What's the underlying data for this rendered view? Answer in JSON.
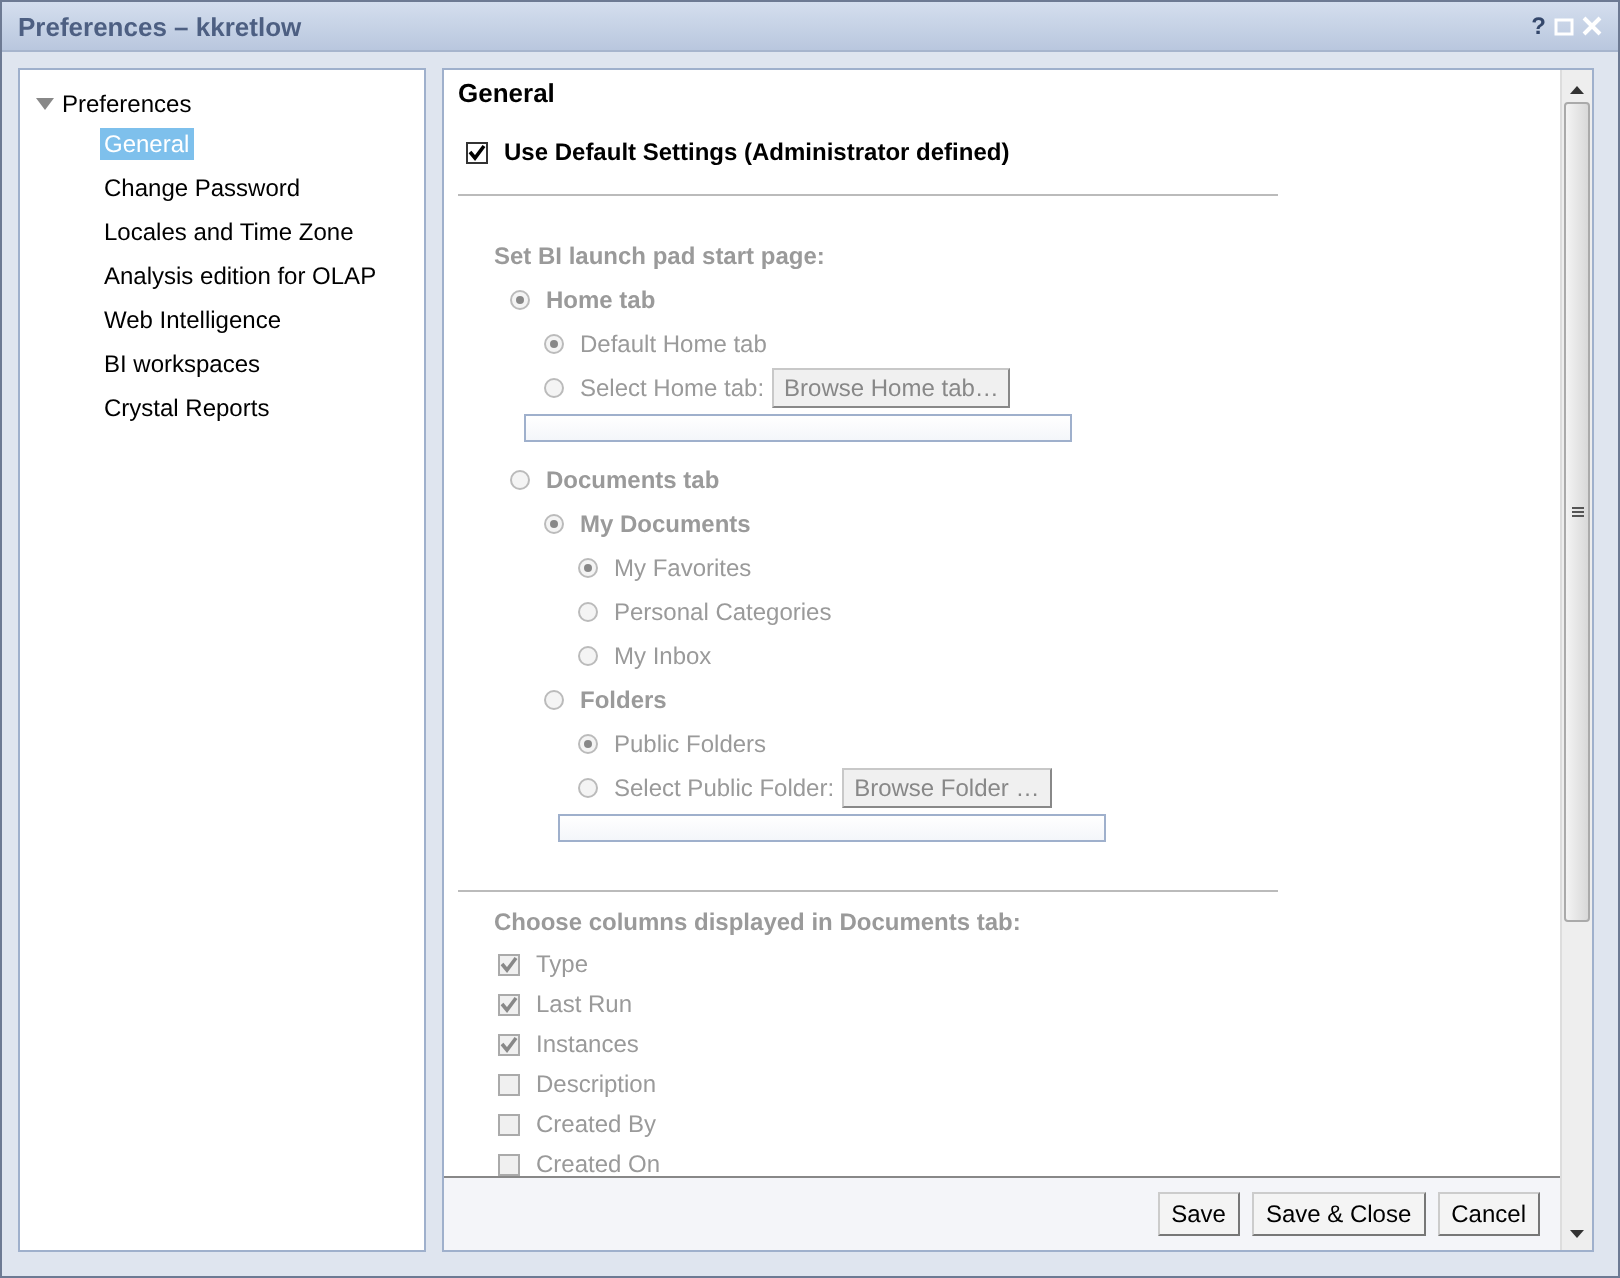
{
  "window": {
    "title": "Preferences – kkretlow",
    "controls": [
      "?"
    ]
  },
  "sidebar": {
    "root": {
      "label": "Preferences",
      "expanded": true,
      "children": [
        {
          "label": "General",
          "selected": true
        },
        {
          "label": "Change Password",
          "selected": false
        },
        {
          "label": "Locales and Time Zone",
          "selected": false
        },
        {
          "label": "Analysis edition for OLAP",
          "selected": false
        },
        {
          "label": "Web Intelligence",
          "selected": false
        },
        {
          "label": "BI workspaces",
          "selected": false
        },
        {
          "label": "Crystal Reports",
          "selected": false
        }
      ]
    }
  },
  "content": {
    "title": "General",
    "use_default": {
      "label": "Use Default Settings (Administrator defined)",
      "checked": true
    },
    "start_page": {
      "heading": "Set BI launch pad start page:",
      "disabled": true,
      "options": [
        {
          "label": "Home tab",
          "selected": true,
          "children": [
            {
              "label": "Default Home tab",
              "selected": true
            },
            {
              "label": "Select Home tab:",
              "selected": false,
              "button": "Browse Home tab…"
            }
          ]
        },
        {
          "label": "Documents tab",
          "selected": false,
          "children": [
            {
              "label": "My Documents",
              "selected": true,
              "children": [
                {
                  "label": "My Favorites",
                  "selected": true
                },
                {
                  "label": "Personal Categories",
                  "selected": false
                },
                {
                  "label": "My Inbox",
                  "selected": false
                }
              ]
            },
            {
              "label": "Folders",
              "selected": false,
              "children": [
                {
                  "label": "Public Folders",
                  "selected": true
                },
                {
                  "label": "Select Public Folder:",
                  "selected": false,
                  "button": "Browse Folder …"
                }
              ]
            }
          ]
        }
      ]
    },
    "columns": {
      "heading": "Choose columns displayed in Documents tab:",
      "disabled": true,
      "items": [
        {
          "label": "Type",
          "checked": true
        },
        {
          "label": "Last Run",
          "checked": true
        },
        {
          "label": "Instances",
          "checked": true
        },
        {
          "label": "Description",
          "checked": false
        },
        {
          "label": "Created By",
          "checked": false
        },
        {
          "label": "Created On",
          "checked": false
        }
      ]
    }
  },
  "buttons": [
    "Save",
    "Save & Close",
    "Cancel"
  ]
}
